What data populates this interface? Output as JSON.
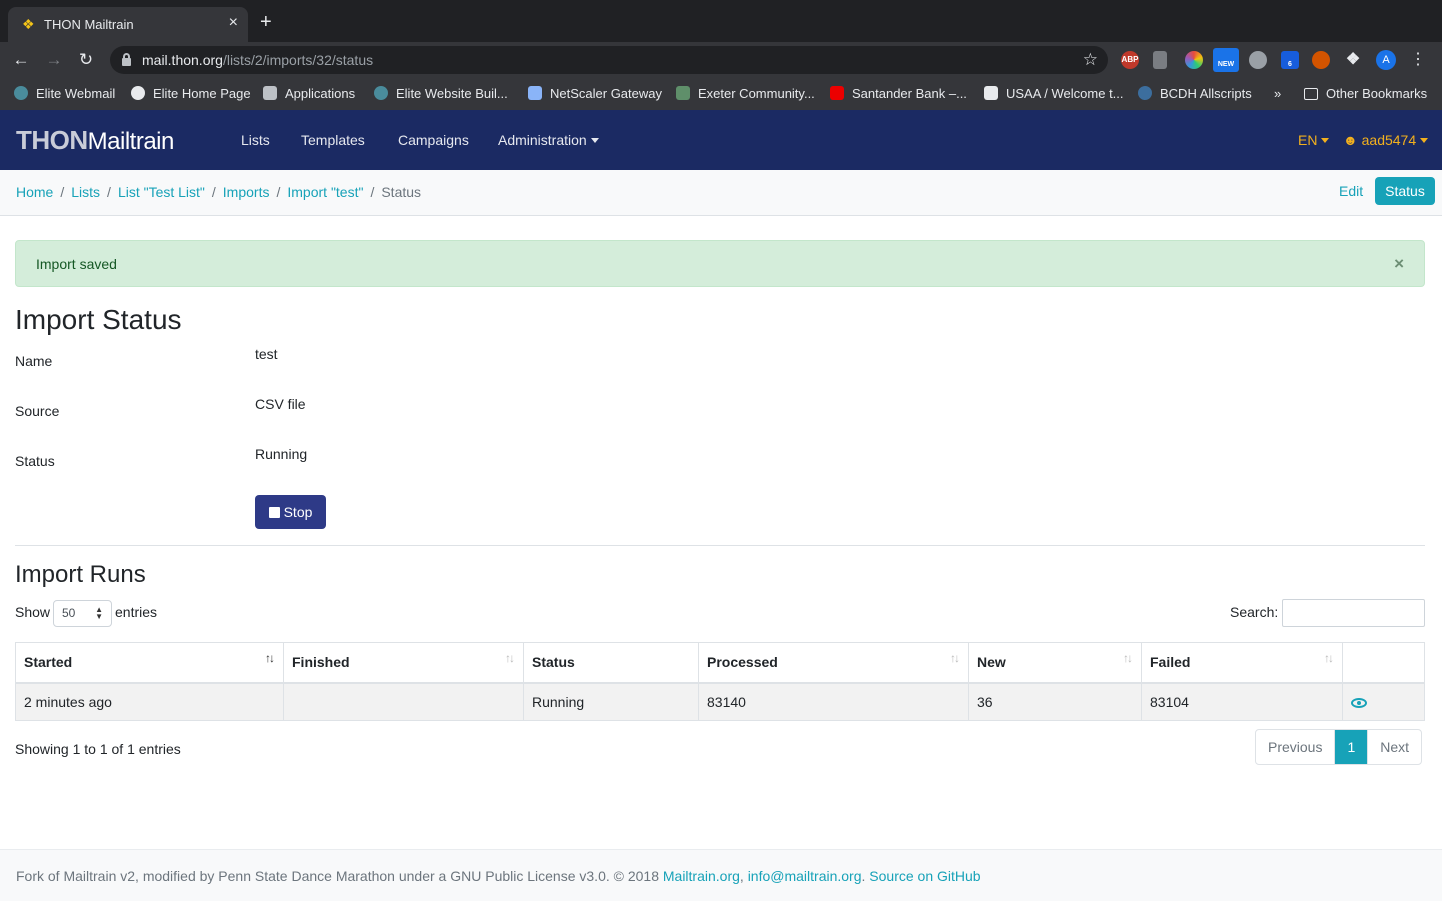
{
  "browser": {
    "tab_title": "THON Mailtrain",
    "url_host": "mail.thon.org",
    "url_path": "/lists/2/imports/32/status",
    "profile_initial": "A",
    "extensions": [
      "ABP",
      "NEW",
      "6"
    ],
    "bookmarks": [
      "Elite Webmail",
      "Elite Home Page",
      "Applications",
      "Elite Website Buil...",
      "NetScaler Gateway",
      "Exeter Community...",
      "Santander Bank –...",
      "USAA / Welcome t...",
      "BCDH Allscripts"
    ],
    "bookmarks_more": "»",
    "other_bookmarks": "Other Bookmarks"
  },
  "navbar": {
    "brand_thon": "THON",
    "brand_mailtrain": "Mailtrain",
    "links": [
      "Lists",
      "Templates",
      "Campaigns",
      "Administration"
    ],
    "language": "EN",
    "user": "aad5474"
  },
  "breadcrumb": {
    "items": [
      "Home",
      "Lists",
      "List \"Test List\"",
      "Imports",
      "Import \"test\""
    ],
    "active": "Status",
    "edit_label": "Edit",
    "status_label": "Status"
  },
  "alert": {
    "text": "Import saved",
    "close": "×"
  },
  "import_status": {
    "title": "Import Status",
    "fields": [
      {
        "label": "Name",
        "value": "test"
      },
      {
        "label": "Source",
        "value": "CSV file"
      },
      {
        "label": "Status",
        "value": "Running"
      }
    ],
    "stop_label": "Stop"
  },
  "import_runs": {
    "title": "Import Runs",
    "show_label": "Show",
    "page_length": "50",
    "entries_label": "entries",
    "search_label": "Search:",
    "columns": [
      "Started",
      "Finished",
      "Status",
      "Processed",
      "New",
      "Failed"
    ],
    "rows": [
      {
        "started": "2 minutes ago",
        "finished": "",
        "status": "Running",
        "processed": "83140",
        "new": "36",
        "failed": "83104"
      }
    ],
    "info": "Showing 1 to 1 of 1 entries",
    "pager": {
      "previous": "Previous",
      "page": "1",
      "next": "Next"
    }
  },
  "footer": {
    "text": "Fork of Mailtrain v2, modified by Penn State Dance Marathon under a GNU Public License v3.0. © 2018 ",
    "link1": "Mailtrain.org",
    "sep": ", ",
    "link2": "info@mailtrain.org",
    "dot": ". ",
    "link3": "Source on GitHub"
  },
  "colors": {
    "navbar": "#1b2a63",
    "accent": "#17a2b8",
    "alert_bg": "#d4edda",
    "stop_button": "#2e3a87",
    "user_menu": "#f2b01e"
  }
}
